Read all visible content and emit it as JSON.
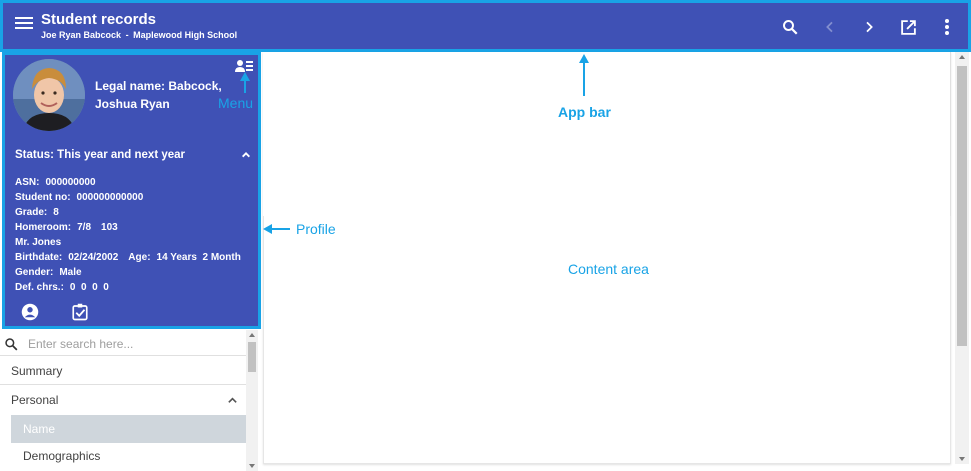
{
  "appbar": {
    "title": "Student records",
    "student_name": "Joe Ryan Babcock",
    "separator": "-",
    "school": "Maplewood High School"
  },
  "profile": {
    "legal_name_line1": "Legal name: Babcock,",
    "legal_name_line2": "Joshua Ryan",
    "status": "Status: This year and next year",
    "asn_label": "ASN:",
    "asn": "000000000",
    "student_no_label": "Student no:",
    "student_no": "000000000000",
    "grade_label": "Grade:",
    "grade": "8",
    "homeroom_label": "Homeroom:",
    "homeroom": "7/8",
    "homeroom_room": "103",
    "teacher": "Mr. Jones",
    "birthdate_label": "Birthdate:",
    "birthdate": "02/24/2002",
    "age_label": "Age:",
    "age": "14 Years  2 Month",
    "gender_label": "Gender:",
    "gender": "Male",
    "def_chrs_label": "Def. chrs.:",
    "def_chrs": "0  0  0  0"
  },
  "nav": {
    "search_placeholder": "Enter search here...",
    "items": [
      {
        "label": "Summary"
      },
      {
        "label": "Personal"
      },
      {
        "label": "Name"
      },
      {
        "label": "Demographics"
      }
    ]
  },
  "annotations": {
    "menu": "Menu",
    "app_bar": "App bar",
    "profile": "Profile",
    "content_area": "Content area"
  },
  "colors": {
    "primary": "#3f51b5",
    "highlight": "#19a3e6",
    "selected_item": "#cfd6dc"
  },
  "icons": {
    "menu": "hamburger-icon",
    "search": "search-icon",
    "back": "chevron-left-icon",
    "forward": "chevron-right-icon",
    "open_new": "open-in-new-icon",
    "more": "more-vert-icon",
    "profile_menu": "person-list-icon",
    "collapse": "chevron-up-icon",
    "person": "account-circle-icon",
    "checklist": "assignment-check-icon"
  }
}
